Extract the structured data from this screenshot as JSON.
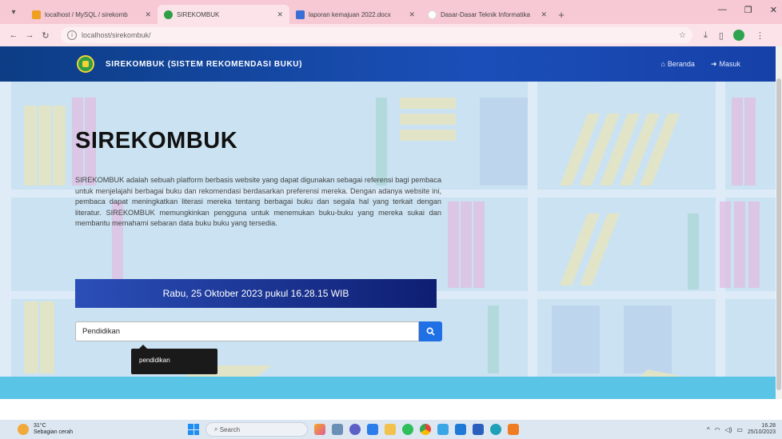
{
  "browser": {
    "tabs": [
      {
        "title": "localhost / MySQL / sirekomb",
        "favicon_color": "#f0a020",
        "active": false
      },
      {
        "title": "SIREKOMBUK",
        "favicon_color": "#2f9e44",
        "active": true
      },
      {
        "title": "laporan kemajuan 2022.docx",
        "favicon_color": "#3b6fd8",
        "active": false
      },
      {
        "title": "Dasar-Dasar Teknik Informatika",
        "favicon_color": "#ffffff",
        "active": false
      }
    ],
    "address": "localhost/sirekombuk/"
  },
  "navbar": {
    "brand": "SIREKOMBUK (SISTEM REKOMENDASI BUKU)",
    "links": [
      {
        "label": "Beranda",
        "icon": "home-icon"
      },
      {
        "label": "Masuk",
        "icon": "login-icon"
      }
    ]
  },
  "hero": {
    "title": "SIREKOMBUK",
    "description": "SIREKOMBUK adalah sebuah platform berbasis website yang dapat digunakan sebagai referensi bagi pembaca untuk menjelajahi berbagai buku dan rekomendasi berdasarkan preferensi mereka. Dengan adanya website ini, pembaca dapat meningkatkan literasi mereka tentang berbagai buku dan segala hal yang terkait dengan literatur. SIREKOMBUK memungkinkan pengguna untuk menemukan buku-buku yang mereka sukai dan membantu memahami sebaran data buku buku yang tersedia.",
    "datetime": "Rabu, 25 Oktober 2023 pukul 16.28.15 WIB",
    "search_value": "Pendidikan",
    "tooltip": "pendidikan"
  },
  "taskbar": {
    "weather_temp": "31°C",
    "weather_desc": "Sebagian cerah",
    "search_label": "Search",
    "time": "16.28",
    "date": "25/10/2023"
  },
  "colors": {
    "navbar": "#1b4fb8",
    "tab_strip": "#f6c9d4",
    "search_button": "#1f6fe5",
    "hero_bg": "#c4e2ef"
  }
}
